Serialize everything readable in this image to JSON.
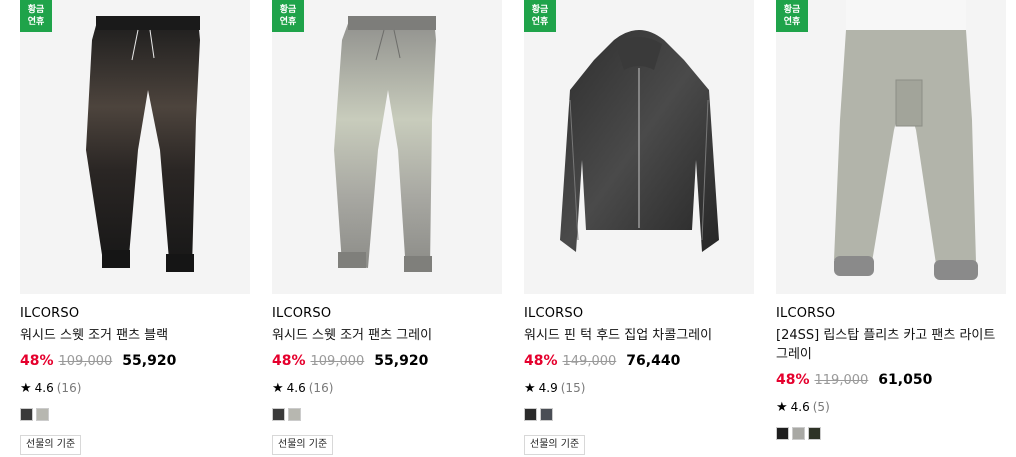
{
  "products": [
    {
      "badge": "황금\n연휴",
      "brand": "ILCORSO",
      "title": "워시드 스웻 조거 팬츠 블랙",
      "discount": "48%",
      "original_price": "109,000",
      "sale_price": "55,920",
      "rating": "4.6",
      "review_count": "(16)",
      "swatches": [
        "#3a3a3a",
        "#b7b7b0"
      ],
      "gift_label": "선물의 기준",
      "image_icon": "black-jogger-pants"
    },
    {
      "badge": "황금\n연휴",
      "brand": "ILCORSO",
      "title": "워시드 스웻 조거 팬츠 그레이",
      "discount": "48%",
      "original_price": "109,000",
      "sale_price": "55,920",
      "rating": "4.6",
      "review_count": "(16)",
      "swatches": [
        "#3a3a3a",
        "#b7b7b0"
      ],
      "gift_label": "선물의 기준",
      "image_icon": "gray-jogger-pants"
    },
    {
      "badge": "황금\n연휴",
      "brand": "ILCORSO",
      "title": "워시드 핀 턱 후드 집업 차콜그레이",
      "discount": "48%",
      "original_price": "149,000",
      "sale_price": "76,440",
      "rating": "4.9",
      "review_count": "(15)",
      "swatches": [
        "#2b2b2b",
        "#4a4e55"
      ],
      "gift_label": "선물의 기준",
      "image_icon": "charcoal-hood-zipup"
    },
    {
      "badge": "황금\n연휴",
      "brand": "ILCORSO",
      "title": "[24SS] 립스탑 플리츠 카고 팬츠 라이트그레이",
      "discount": "48%",
      "original_price": "119,000",
      "sale_price": "61,050",
      "rating": "4.6",
      "review_count": "(5)",
      "swatches": [
        "#1e1e1e",
        "#a8a8a4",
        "#2e3326"
      ],
      "gift_label": "",
      "image_icon": "light-gray-cargo-pants"
    }
  ],
  "colors": {
    "badge": "#1fa34a",
    "discount": "#e5002d",
    "original_price": "#9a9a9a"
  }
}
